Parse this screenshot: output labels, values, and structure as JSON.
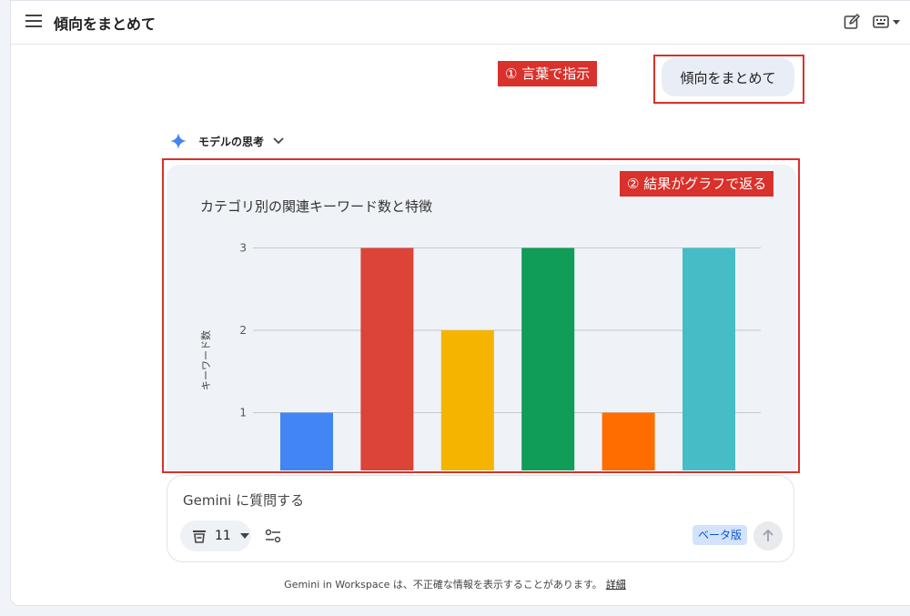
{
  "header": {
    "title": "傾向をまとめて",
    "icons": [
      "menu-icon",
      "edit-icon",
      "keyboard-icon",
      "dropdown-arrow-icon"
    ]
  },
  "annotations": {
    "step1": "① 言葉で指示",
    "step2": "② 結果がグラフで返る",
    "color": "#d9312b"
  },
  "chat": {
    "user_message": "傾向をまとめて",
    "thinking_label": "モデルの思考",
    "sparkle_color": "#4285f4"
  },
  "chart_data": {
    "type": "bar",
    "title": "カテゴリ別の関連キーワード数と特徴",
    "ylabel": "キーワード数",
    "xlabel": "",
    "yticks": [
      1,
      2,
      3
    ],
    "ylim_top": 3,
    "values": [
      1,
      3,
      2,
      3,
      1,
      3
    ],
    "colors": [
      "#4285f4",
      "#db4437",
      "#f4b400",
      "#0f9d58",
      "#ff6d01",
      "#46bdc6"
    ],
    "grid": true
  },
  "composer": {
    "placeholder": "Gemini に質問する",
    "source_count": "11",
    "beta_label": "ベータ版"
  },
  "footer": {
    "disclaimer": "Gemini in Workspace は、不正確な情報を表示することがあります。",
    "details_link": "詳細"
  }
}
